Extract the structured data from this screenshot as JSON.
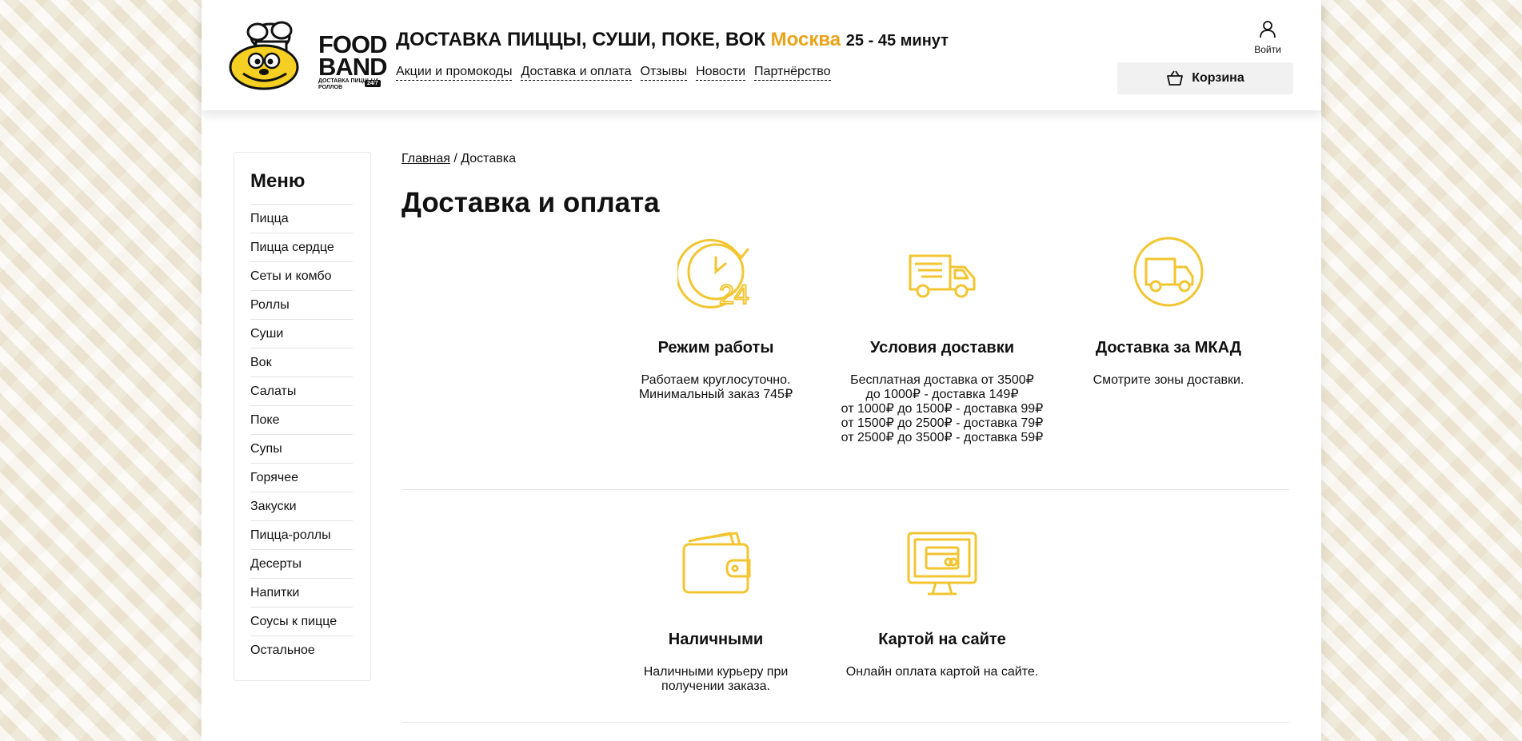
{
  "header": {
    "logo_line1": "FOOD",
    "logo_line2": "BAND",
    "logo_sub": "ДОСТАВКА ПИЦЦЫ И РОЛЛОВ",
    "logo_badge": "24/7",
    "headline": "ДОСТАВКА ПИЦЦЫ, СУШИ, ПОКЕ, ВОК",
    "city": "Москва",
    "delivery_time": "25 - 45 минут",
    "nav": [
      "Акции и промокоды",
      "Доставка и оплата",
      "Отзывы",
      "Новости",
      "Партнёрство"
    ],
    "login_label": "Войти",
    "cart_label": "Корзина"
  },
  "sidebar": {
    "title": "Меню",
    "items": [
      "Пицца",
      "Пицца сердце",
      "Сеты и комбо",
      "Роллы",
      "Суши",
      "Вок",
      "Салаты",
      "Поке",
      "Супы",
      "Горячее",
      "Закуски",
      "Пицца-роллы",
      "Десерты",
      "Напитки",
      "Соусы к пицце",
      "Остальное"
    ]
  },
  "breadcrumb": {
    "home": "Главная",
    "separator": "/",
    "current": "Доставка"
  },
  "page_title": "Доставка и оплата",
  "accent_color": "#f2c531",
  "delivery_cards": [
    {
      "icon": "clock-24-icon",
      "title": "Режим работы",
      "lines": [
        "Работаем круглосуточно.",
        "Минимальный заказ 745₽"
      ]
    },
    {
      "icon": "delivery-truck-icon",
      "title": "Условия доставки",
      "lines": [
        "Бесплатная доставка от 3500₽",
        "до 1000₽ -  доставка 149₽",
        "от 1000₽ до 1500₽ - доставка 99₽",
        "от 1500₽ до 2500₽ - доставка 79₽",
        "от 2500₽ до 3500₽ - доставка 59₽"
      ]
    },
    {
      "icon": "truck-circle-icon",
      "title": "Доставка за МКАД",
      "lines": [
        "Смотрите зоны доставки."
      ]
    }
  ],
  "payment_cards": [
    {
      "icon": "wallet-icon",
      "title": "Наличными",
      "lines": [
        "Наличными курьеру при",
        "получении заказа."
      ]
    },
    {
      "icon": "card-monitor-icon",
      "title": "Картой на сайте",
      "lines": [
        "Онлайн оплата картой на сайте."
      ]
    }
  ]
}
